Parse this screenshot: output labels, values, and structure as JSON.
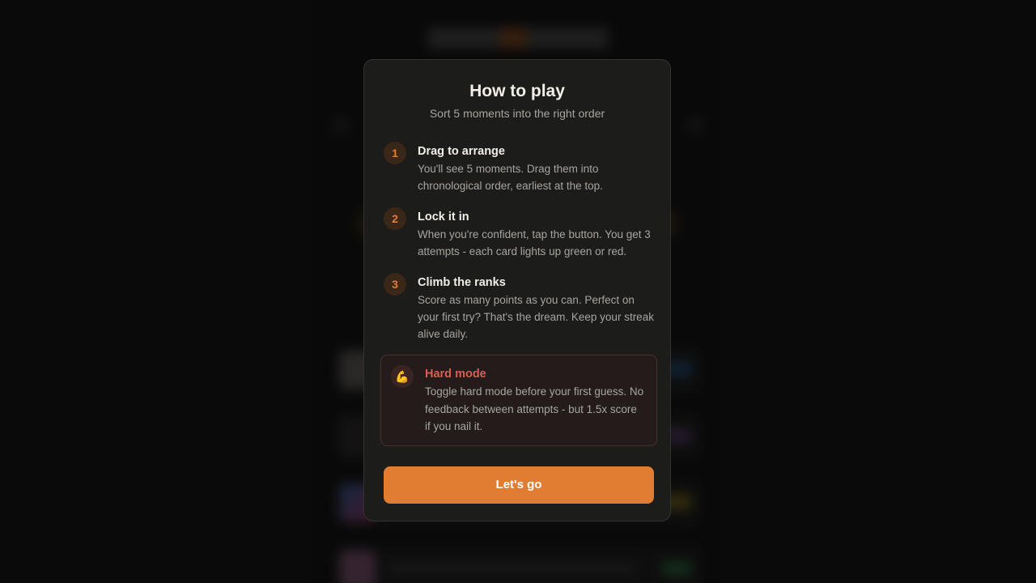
{
  "modal": {
    "title": "How to play",
    "subtitle": "Sort 5 moments into the right order",
    "steps": [
      {
        "number": "1",
        "title": "Drag to arrange",
        "text": "You'll see 5 moments. Drag them into chronological order, earliest at the top."
      },
      {
        "number": "2",
        "title": "Lock it in",
        "text": "When you're confident, tap the button. You get 3 attempts - each card lights up green or red."
      },
      {
        "number": "3",
        "title": "Climb the ranks",
        "text": "Score as many points as you can. Perfect on your first try? That's the dream. Keep your streak alive daily."
      }
    ],
    "hard_mode": {
      "icon": "flexed-biceps-icon",
      "icon_glyph": "💪",
      "title": "Hard mode",
      "text": "Toggle hard mode before your first guess. No feedback between attempts - but 1.5x score if you nail it."
    },
    "button_label": "Let's go"
  },
  "colors": {
    "accent": "#e07d33",
    "hard_mode_title": "#d95f55",
    "modal_background": "#1c1c1b",
    "page_background": "#0f0f0f"
  }
}
